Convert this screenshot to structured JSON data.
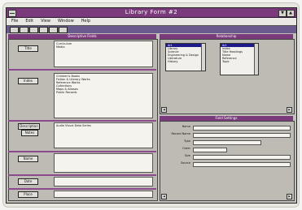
{
  "window": {
    "title": "Library Form #2",
    "menu": [
      "File",
      "Edit",
      "View",
      "Window",
      "Help"
    ]
  },
  "left_panel": {
    "header": "Descriptive Fields",
    "rows": [
      {
        "button": "Title",
        "text": "Curriculum\nMedia"
      },
      {
        "button": "Index",
        "text": "Children's Books\nFiction & Literary Works\nReference Works\nCollections\nMaps & Atlases\nPublic Records"
      },
      {
        "button": "Description",
        "sub_button": "Notes",
        "text": "Audio Visual Data  Series"
      },
      {
        "button": "Name",
        "text": ""
      },
      {
        "button": "Date",
        "text": ""
      },
      {
        "button": "Place",
        "text": ""
      }
    ]
  },
  "top_right_panel": {
    "header": "Relationship",
    "list_left": {
      "items": [
        "Art",
        "Library",
        "Science",
        "Engineering & Design",
        "Literature",
        "History"
      ],
      "selected": 0
    },
    "list_right": {
      "items": [
        "Art",
        "Index",
        "Title Headings",
        "Name",
        "Reference",
        "Topic"
      ],
      "selected": 0
    }
  },
  "bottom_right_panel": {
    "header": "Field Settings",
    "fields": [
      {
        "label": "Name"
      },
      {
        "label": "Record Name"
      },
      {
        "label": "Type"
      },
      {
        "label": "Order"
      },
      {
        "label": "Size"
      },
      {
        "label": "Source"
      }
    ]
  },
  "colors": {
    "titlebar": "#7b3a7c",
    "toolbar": "#6a5a8e",
    "selection": "#1f1a8a",
    "window_bg": "#c3c1bb"
  }
}
